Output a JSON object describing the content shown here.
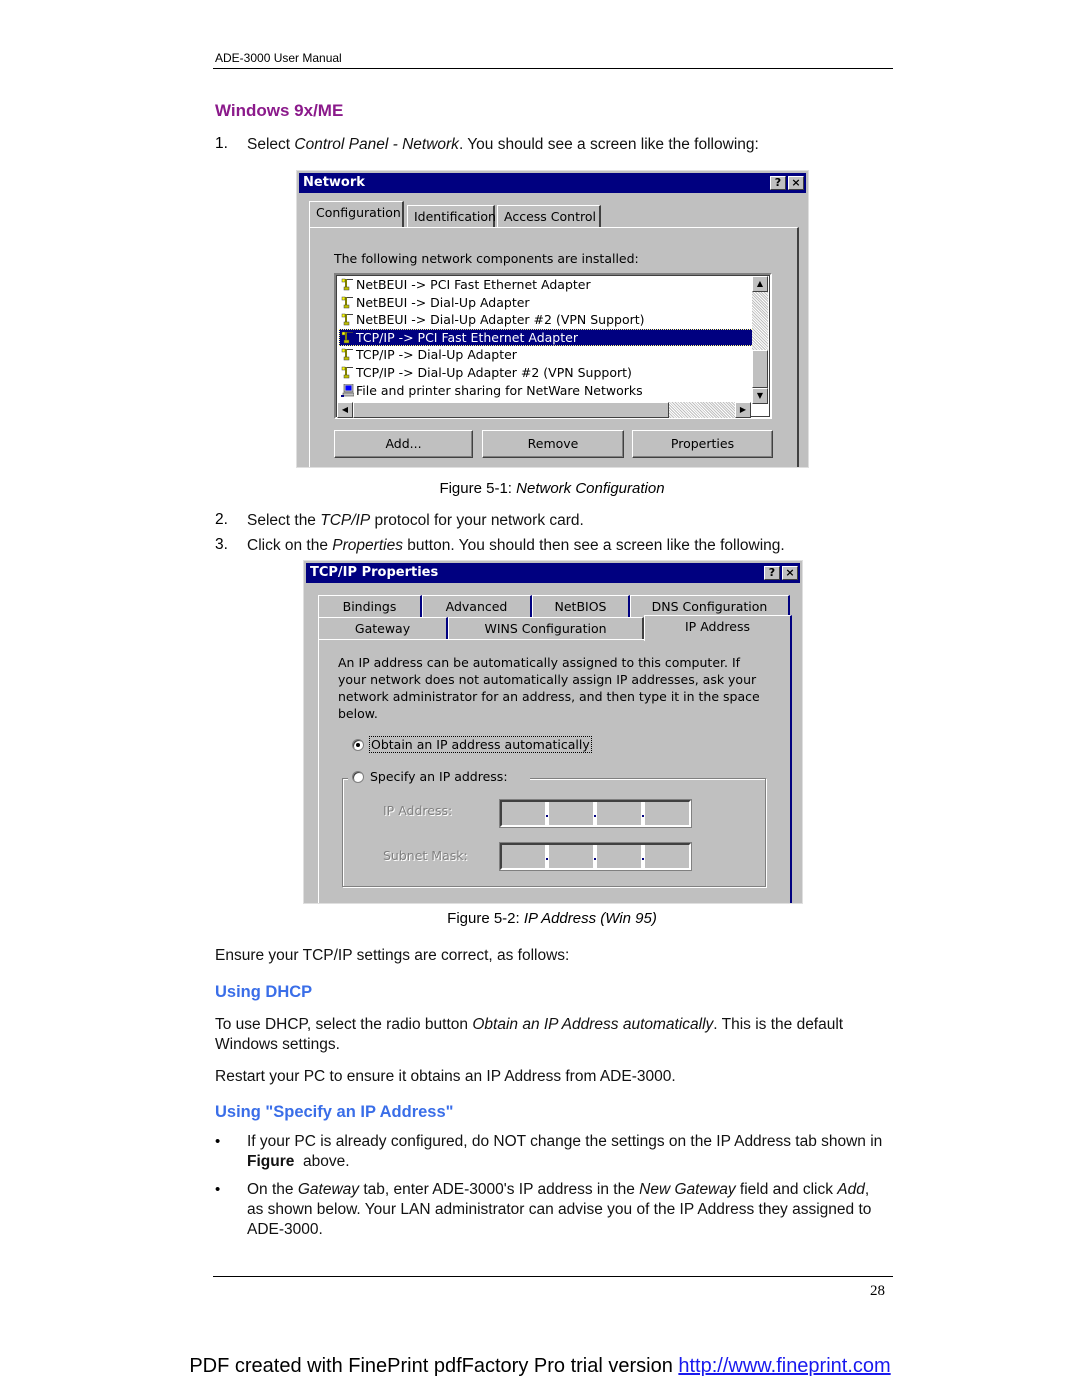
{
  "header": {
    "running_head": "ADE-3000 User Manual"
  },
  "section_windows": {
    "title": "Windows 9x/ME",
    "step1": {
      "num": "1.",
      "pre": "Select ",
      "em": "Control Panel - Network",
      "post": ". You should see a screen like the following:"
    }
  },
  "network_dialog": {
    "title": "Network",
    "help_button": "?",
    "close_button": "×",
    "tabs": [
      "Configuration",
      "Identification",
      "Access Control"
    ],
    "active_tab": "Configuration",
    "components_label": "The following network components are installed:",
    "components": [
      {
        "label": "NetBEUI -> PCI Fast Ethernet Adapter",
        "icon": "protocol-icon",
        "selected": false
      },
      {
        "label": "NetBEUI -> Dial-Up Adapter",
        "icon": "protocol-icon",
        "selected": false
      },
      {
        "label": "NetBEUI -> Dial-Up Adapter #2 (VPN Support)",
        "icon": "protocol-icon",
        "selected": false
      },
      {
        "label": "TCP/IP -> PCI Fast Ethernet Adapter",
        "icon": "protocol-icon",
        "selected": true
      },
      {
        "label": "TCP/IP -> Dial-Up Adapter",
        "icon": "protocol-icon",
        "selected": false
      },
      {
        "label": "TCP/IP -> Dial-Up Adapter #2 (VPN Support)",
        "icon": "protocol-icon",
        "selected": false
      },
      {
        "label": "File and printer sharing for NetWare Networks",
        "icon": "computer-icon",
        "selected": false
      }
    ],
    "buttons": {
      "add": "Add...",
      "remove": "Remove",
      "properties": "Properties"
    }
  },
  "figure1": {
    "prefix": "Figure 5-1: ",
    "title": "Network Configuration"
  },
  "steps_2_3": [
    {
      "num": "2.",
      "pre": "Select the ",
      "em": "TCP/IP",
      "post": " protocol for your network card."
    },
    {
      "num": "3.",
      "pre": "Click on the ",
      "em": "Properties",
      "post": " button. You should then see a screen like the following."
    }
  ],
  "tcpip_dialog": {
    "title": "TCP/IP Properties",
    "help_button": "?",
    "close_button": "×",
    "tabs_row1": [
      "Bindings",
      "Advanced",
      "NetBIOS",
      "DNS Configuration"
    ],
    "tabs_row2": [
      "Gateway",
      "WINS Configuration",
      "IP Address"
    ],
    "active_tab": "IP Address",
    "description": "An IP address can be automatically assigned to this computer. If your network does not automatically assign IP addresses, ask your network administrator for an address, and then type it in the space below.",
    "radio_obtain": "Obtain an IP address automatically",
    "radio_specify": "Specify an IP address:",
    "selected_option": "obtain",
    "ip_address_label": "IP Address:",
    "subnet_mask_label": "Subnet Mask:",
    "ip_address_value": [
      "",
      "",
      "",
      ""
    ],
    "subnet_mask_value": [
      "",
      "",
      "",
      ""
    ]
  },
  "figure2": {
    "prefix": "Figure 5-2: ",
    "title": "IP Address (Win 95)"
  },
  "ensure_text": "Ensure your TCP/IP settings are correct, as follows:",
  "section_dhcp": {
    "title": "Using DHCP",
    "para1_pre": "To use DHCP, select the radio button ",
    "para1_em": "Obtain an IP Address automatically",
    "para1_post": ". This is the default Windows settings.",
    "para2": "Restart your PC to ensure it obtains an IP Address from ADE-3000."
  },
  "section_specify": {
    "title": "Using \"Specify an IP Address\"",
    "bullet_char": "•",
    "bullet1_pre": "If your PC is already configured, do NOT change the settings on the IP Address tab shown in ",
    "bullet1_bold": "Figure",
    "bullet1_post": "  above.",
    "bullet2_a": "On the ",
    "bullet2_em1": "Gateway",
    "bullet2_b": " tab, enter ADE-3000's IP address in the ",
    "bullet2_em2": "New Gateway",
    "bullet2_c": " field and click ",
    "bullet2_em3": "Add",
    "bullet2_d": ", as shown below. Your LAN administrator can advise you of the IP Address they assigned to ADE-3000."
  },
  "footer": {
    "page_number": "28"
  },
  "watermark": {
    "text": "PDF created with FinePrint pdfFactory Pro trial version ",
    "link": "http://www.fineprint.com"
  },
  "colors": {
    "heading_purple": "#8b1a8b",
    "heading_blue": "#3a6ee8",
    "win_titlebar": "#000080",
    "win_face": "#c0c0c0",
    "link": "#1a1aee"
  }
}
